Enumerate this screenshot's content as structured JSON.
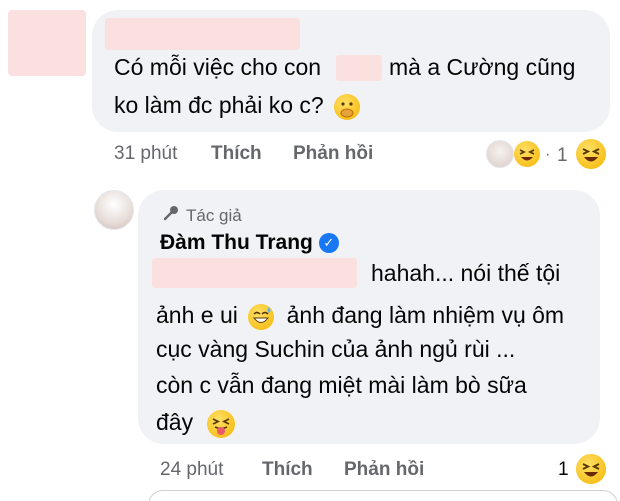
{
  "comment1": {
    "text_before": "Có mỗi việc cho con",
    "text_after": "mà a Cường cũng",
    "text_line2": "ko làm đc phải ko c?",
    "emoji": "face-with-hand-over-mouth-emoji",
    "time": "31 phút",
    "like_label": "Thích",
    "reply_label": "Phản hồi",
    "reaction_count": "1"
  },
  "reply": {
    "author_tag": "Tác giả",
    "author_name": "Đàm Thu Trang",
    "line1": "hahah... nói thế tội",
    "line2": "ảnh e ui",
    "line2_rest": "ảnh đang làm nhiệm vụ ôm",
    "line3": "cục vàng Suchin của ảnh ngủ rùi ...",
    "line4": "còn c vẫn đang miệt mài làm bò sữa",
    "line5": "đây",
    "time": "24 phút",
    "like_label": "Thích",
    "reply_label": "Phản hồi",
    "reaction_count": "1"
  },
  "colors": {
    "bubble_bg": "#f0f2f5",
    "meta_text": "#65676b",
    "verified": "#1877f2",
    "redaction": "#fbe0e0"
  }
}
